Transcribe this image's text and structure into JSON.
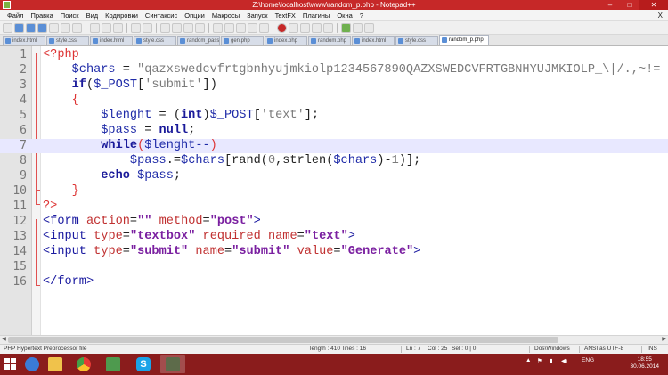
{
  "window": {
    "title": "Z:\\home\\localhost\\www\\random_p.php - Notepad++",
    "minimize": "–",
    "maximize": "□",
    "close": "✕"
  },
  "menu": [
    "Файл",
    "Правка",
    "Поиск",
    "Вид",
    "Кодировки",
    "Синтаксис",
    "Опции",
    "Макросы",
    "Запуск",
    "TextFX",
    "Плагины",
    "Окна",
    "?"
  ],
  "menu_close": "X",
  "tabs": [
    {
      "label": "index.html"
    },
    {
      "label": "style.css"
    },
    {
      "label": "index.html"
    },
    {
      "label": "style.css"
    },
    {
      "label": "random_pass.php"
    },
    {
      "label": "gen.php"
    },
    {
      "label": "index.php"
    },
    {
      "label": "random.php"
    },
    {
      "label": "index.html"
    },
    {
      "label": "style.css"
    },
    {
      "label": "random_p.php",
      "active": true
    }
  ],
  "editor": {
    "line_numbers": [
      "1",
      "2",
      "3",
      "4",
      "5",
      "6",
      "7",
      "8",
      "9",
      "10",
      "11",
      "12",
      "13",
      "14",
      "15",
      "16"
    ],
    "current_line": 7
  },
  "status": {
    "file_type": "PHP Hypertext Preprocessor file",
    "length": "length : 410",
    "lines": "lines : 16",
    "position": "Ln : 7",
    "col": "Col : 25",
    "sel": "Sel : 0 | 0",
    "eol": "Dos\\Windows",
    "encoding": "ANSI as UTF-8",
    "mode": "INS"
  },
  "taskbar": {
    "lang": "ENG",
    "time": "18:55",
    "date": "30.06.2014"
  },
  "colors": {
    "titlebar": "#c62828",
    "taskbar": "#8a1c1c",
    "current_line": "#e8e8ff",
    "keyword": "#1a1a9a",
    "variable": "#1f2ba8",
    "string": "#7a7a7a",
    "php_tag": "#d33333",
    "attr_value": "#7a1fa0"
  },
  "icons": [
    "notepadpp-icon",
    "windows-start-icon",
    "folder-icon",
    "chrome-icon",
    "photos-icon",
    "skype-icon",
    "notepadpp-taskbar-icon"
  ]
}
